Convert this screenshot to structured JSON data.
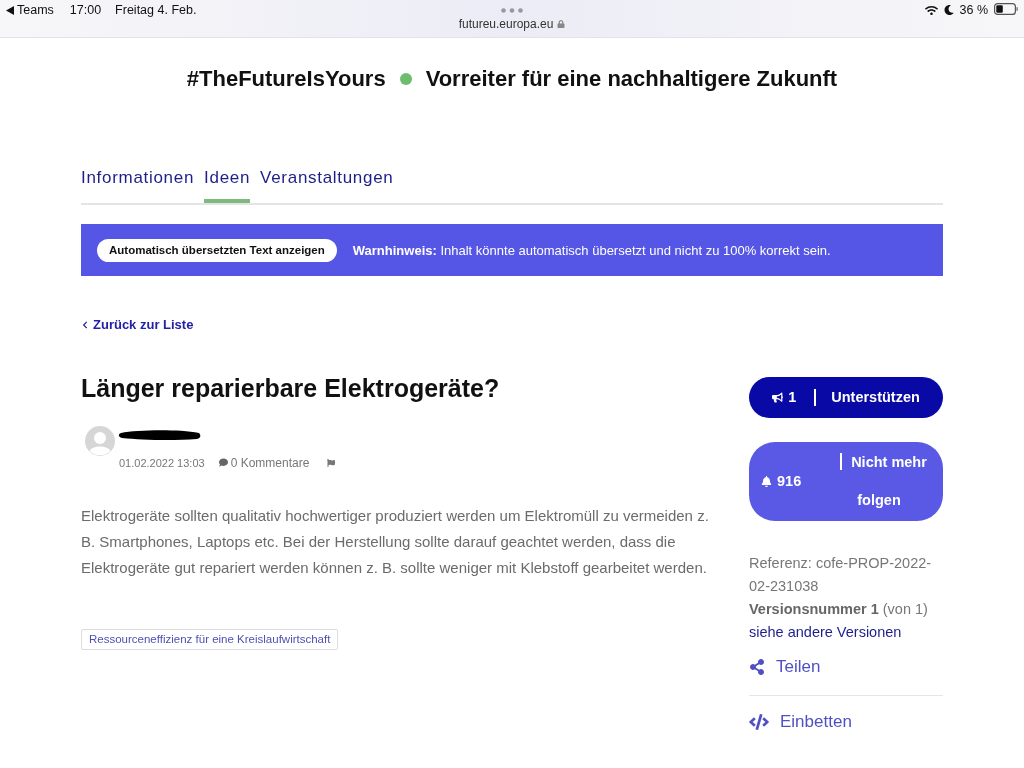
{
  "status_bar": {
    "back_app": "Teams",
    "time": "17:00",
    "date": "Freitag 4. Feb.",
    "url": "futureu.europa.eu",
    "battery": "36 %"
  },
  "header": {
    "hashtag": "#TheFutureIsYours",
    "tagline": "Vorreiter für eine nachhaltigere Zukunft"
  },
  "tabs": [
    {
      "label": "Informationen",
      "selected": false
    },
    {
      "label": "Ideen",
      "selected": true
    },
    {
      "label": "Veranstaltungen",
      "selected": false
    }
  ],
  "translation_banner": {
    "button": "Automatisch übersetzten Text anzeigen",
    "notice": "**Warnhinweis:** Inhalt könnte automatisch übersetzt und nicht zu 100% korrekt sein."
  },
  "back_link": "Zurück zur Liste",
  "proposal": {
    "title": "Länger reparierbare Elektrogeräte?",
    "author_redacted": true,
    "date": "01.02.2022 13:03",
    "comments": "0 Kommentare",
    "body": "Elektrogeräte sollten qualitativ hochwertiger produziert werden um Elektromüll zu vermeiden z. B. Smartphones, Laptops etc. Bei der Herstellung sollte darauf geachtet werden, dass die Elektrogeräte gut repariert werden können z. B. sollte weniger mit Klebstoff gearbeitet werden.",
    "tags": [
      "Ressourceneffizienz für eine Kreislaufwirtschaft"
    ]
  },
  "sidebar": {
    "support": {
      "count": "1",
      "label": "Unterstützen"
    },
    "follow": {
      "count": "916",
      "label": "Nicht mehr folgen"
    },
    "reference": "Referenz: cofe-PROP-2022-02-231038",
    "version": "**Versionsnummer 1** (von 1)",
    "versions_link": "siehe andere Versionen",
    "actions": [
      {
        "kind": "share",
        "label": "Teilen"
      },
      {
        "kind": "embed",
        "label": "Einbetten"
      }
    ]
  }
}
